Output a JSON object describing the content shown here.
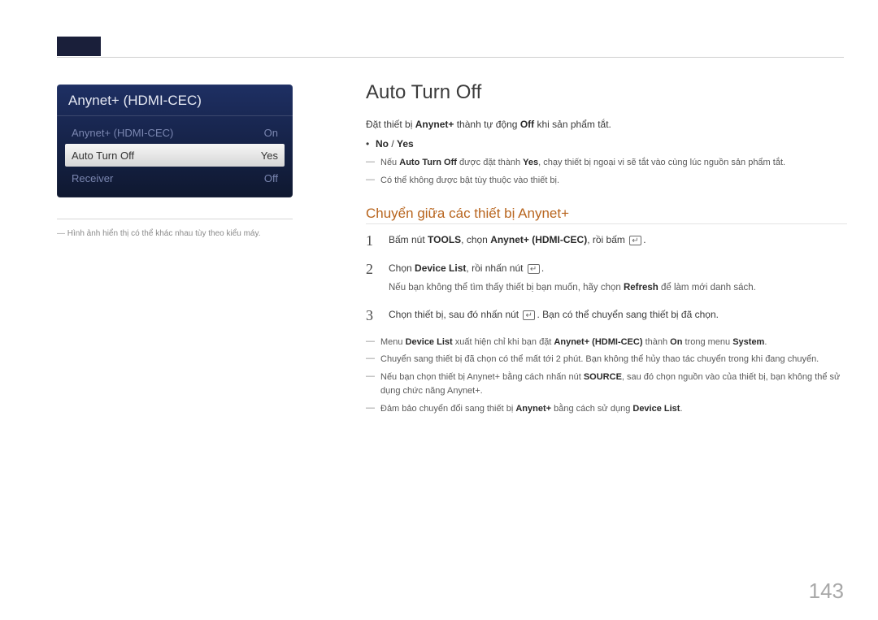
{
  "header": {},
  "panel": {
    "title": "Anynet+ (HDMI-CEC)",
    "rows": [
      {
        "label": "Anynet+ (HDMI-CEC)",
        "value": "On",
        "style": "dim"
      },
      {
        "label": "Auto Turn Off",
        "value": "Yes",
        "style": "active"
      },
      {
        "label": "Receiver",
        "value": "Off",
        "style": "dim"
      }
    ]
  },
  "caption": "Hình ảnh hiển thị có thể khác nhau tùy theo kiểu máy.",
  "main": {
    "heading": "Auto Turn Off",
    "intro_pre": "Đặt thiết bị ",
    "intro_accent1": "Anynet+",
    "intro_mid": " thành tự động ",
    "intro_accent2": "Off",
    "intro_post": " khi sản phẩm tắt.",
    "options_no": "No",
    "options_slash": " / ",
    "options_yes": "Yes",
    "dash1_pre": "Nếu ",
    "dash1_ac1": "Auto Turn Off",
    "dash1_mid": " được đặt thành ",
    "dash1_ac2": "Yes",
    "dash1_post": ", chạy thiết bị ngoại vi sẽ tắt vào cùng lúc nguồn sản phẩm tắt.",
    "dash2": "Có thể không được bật tùy thuộc vào thiết bị.",
    "h2": "Chuyển giữa các thiết bị Anynet+",
    "steps": [
      {
        "num": "1",
        "pre": "Bấm nút ",
        "bold1": "TOOLS",
        "mid": ", chọn ",
        "ac1": "Anynet+ (HDMI-CEC)",
        "post": ", rồi bấm"
      },
      {
        "num": "2",
        "pre": "Chọn ",
        "ac1": "Device List",
        "post": ", rồi nhấn nút",
        "sub_pre": "Nếu bạn không thể tìm thấy thiết bị bạn muốn, hãy chọn ",
        "sub_ac": "Refresh",
        "sub_post": " để làm mới danh sách."
      },
      {
        "num": "3",
        "pre": "Chọn thiết bị, sau đó nhấn nút",
        "post2": ". Bạn có thể chuyển sang thiết bị đã chọn."
      }
    ],
    "notes": [
      {
        "pre": "Menu ",
        "ac1": "Device List",
        "mid1": " xuất hiện chỉ khi bạn đặt ",
        "ac2": "Anynet+ (HDMI-CEC)",
        "mid2": " thành ",
        "ac3": "On",
        "mid3": " trong menu ",
        "ac4": "System",
        "post": "."
      },
      {
        "plain": "Chuyển sang thiết bị đã chọn có thể mất tới 2 phút. Bạn không thể hủy thao tác chuyển trong khi đang chuyển."
      },
      {
        "pre": "Nếu bạn chọn thiết bị Anynet+ bằng cách nhấn nút ",
        "bold1": "SOURCE",
        "post": ", sau đó chọn nguồn vào của thiết bị, bạn không thể sử dụng chức năng Anynet+."
      },
      {
        "pre": "Đảm bảo chuyển đổi sang thiết bị ",
        "ac1": "Anynet+",
        "mid1": " bằng cách sử dụng ",
        "ac2": "Device List",
        "post": "."
      }
    ]
  },
  "page_number": "143"
}
